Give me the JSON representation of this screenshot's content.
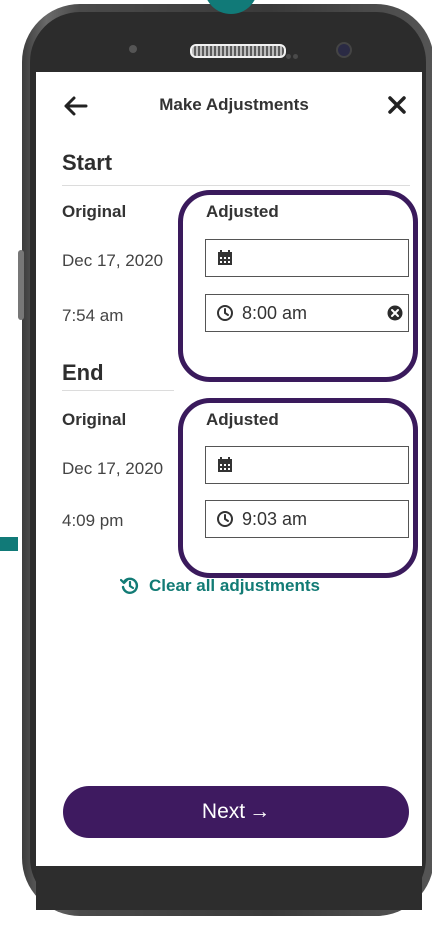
{
  "header": {
    "title": "Make Adjustments",
    "back_icon": "arrow-left-icon",
    "close_icon": "close-x-icon"
  },
  "start": {
    "section_title": "Start",
    "original_label": "Original",
    "adjusted_label": "Adjusted",
    "original_date": "Dec 17, 2020",
    "original_time": "7:54  am",
    "adjusted_date": "",
    "adjusted_time": "8:00 am"
  },
  "end": {
    "section_title": "End",
    "original_label": "Original",
    "adjusted_label": "Adjusted",
    "original_date": "Dec 17, 2020",
    "original_time": "4:09 pm",
    "adjusted_date": "",
    "adjusted_time": "9:03 am"
  },
  "clear_link": {
    "label": "Clear all adjustments",
    "icon": "history-icon"
  },
  "next_button": {
    "label": "Next",
    "icon": "→"
  },
  "colors": {
    "primary": "#3e1a60",
    "highlight": "#3a1a5c",
    "accent": "#127b75",
    "teal": "#117a78"
  }
}
